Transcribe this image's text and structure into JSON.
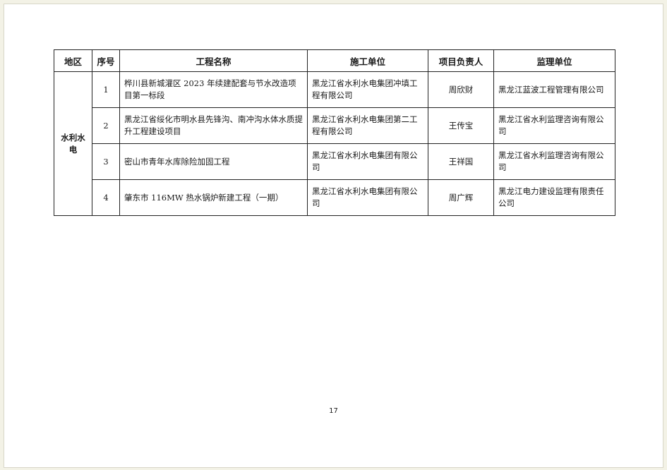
{
  "table": {
    "headers": {
      "region": "地区",
      "index": "序号",
      "project_name": "工程名称",
      "construction_unit": "施工单位",
      "project_leader": "项目负责人",
      "supervision_unit": "监理单位"
    },
    "region": "水利水电",
    "rows": [
      {
        "index": "1",
        "project_name": "桦川县新城灌区 2023 年续建配套与节水改造项目第一标段",
        "construction_unit": "黑龙江省水利水电集团冲填工程有限公司",
        "project_leader": "周欣财",
        "supervision_unit": "黑龙江蓝波工程管理有限公司"
      },
      {
        "index": "2",
        "project_name": "黑龙江省绥化市明水县先锋沟、南冲沟水体水质提升工程建设项目",
        "construction_unit": "黑龙江省水利水电集团第二工程有限公司",
        "project_leader": "王传宝",
        "supervision_unit": "黑龙江省水利监理咨询有限公司"
      },
      {
        "index": "3",
        "project_name": "密山市青年水库除险加固工程",
        "construction_unit": "黑龙江省水利水电集团有限公司",
        "project_leader": "王祥国",
        "supervision_unit": "黑龙江省水利监理咨询有限公司"
      },
      {
        "index": "4",
        "project_name": "肇东市 116MW 热水锅炉新建工程（一期）",
        "construction_unit": "黑龙江省水利水电集团有限公司",
        "project_leader": "周广辉",
        "supervision_unit": "黑龙江电力建设监理有限责任公司"
      }
    ]
  },
  "page_number": "17"
}
